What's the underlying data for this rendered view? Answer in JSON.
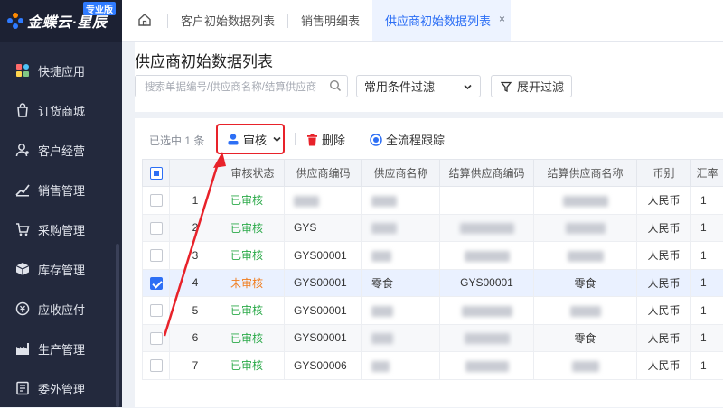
{
  "brand": {
    "name": "金蝶云·星辰",
    "edition": "专业版"
  },
  "sidebar": {
    "items": [
      {
        "label": "快捷应用",
        "icon": "grid-apps-icon"
      },
      {
        "label": "订货商城",
        "icon": "shopping-bag-icon"
      },
      {
        "label": "客户经营",
        "icon": "customer-icon"
      },
      {
        "label": "销售管理",
        "icon": "sales-chart-icon"
      },
      {
        "label": "采购管理",
        "icon": "shopping-cart-icon"
      },
      {
        "label": "库存管理",
        "icon": "box-icon"
      },
      {
        "label": "应收应付",
        "icon": "finance-icon"
      },
      {
        "label": "生产管理",
        "icon": "factory-icon"
      },
      {
        "label": "委外管理",
        "icon": "outsource-icon"
      }
    ]
  },
  "tabs": [
    {
      "label": "客户初始数据列表"
    },
    {
      "label": "销售明细表"
    },
    {
      "label": "供应商初始数据列表",
      "close": "×"
    }
  ],
  "page": {
    "title": "供应商初始数据列表",
    "search_placeholder": "搜索单据编号/供应商名称/结算供应商",
    "filter_label": "常用条件过滤",
    "expand_label": "展开过滤"
  },
  "toolbar": {
    "selected": "已选中 1 条",
    "audit": "审核",
    "delete": "删除",
    "trace": "全流程跟踪"
  },
  "table": {
    "headers": [
      "",
      "",
      "审核状态",
      "供应商编码",
      "供应商名称",
      "结算供应商编码",
      "结算供应商名称",
      "币别",
      "汇率"
    ],
    "rows": [
      {
        "no": "1",
        "status": "已审核",
        "code": "",
        "name": "",
        "settle_code": "",
        "settle_name": "",
        "currency": "人民币",
        "rate": "1"
      },
      {
        "no": "2",
        "status": "已审核",
        "code": "GYS",
        "name": "",
        "settle_code": "",
        "settle_name": "",
        "currency": "人民币",
        "rate": "1"
      },
      {
        "no": "3",
        "status": "已审核",
        "code": "GYS00001",
        "name": "",
        "settle_code": "",
        "settle_name": "",
        "currency": "人民币",
        "rate": "1"
      },
      {
        "no": "4",
        "status": "未审核",
        "code": "GYS00001",
        "name": "零食",
        "settle_code": "GYS00001",
        "settle_name": "零食",
        "currency": "人民币",
        "rate": "1"
      },
      {
        "no": "5",
        "status": "已审核",
        "code": "GYS00001",
        "name": "",
        "settle_code": "",
        "settle_name": "",
        "currency": "人民币",
        "rate": "1"
      },
      {
        "no": "6",
        "status": "已审核",
        "code": "GYS00001",
        "name": "",
        "settle_code": "",
        "settle_name": "零食",
        "currency": "人民币",
        "rate": "1"
      },
      {
        "no": "7",
        "status": "已审核",
        "code": "GYS00006",
        "name": "",
        "settle_code": "",
        "settle_name": "",
        "currency": "人民币",
        "rate": "1"
      }
    ]
  },
  "colors": {
    "accent": "#2d6ff5",
    "approved": "#2caa4a",
    "pending": "#f07d1e",
    "highlight": "#e8222a",
    "sidebar": "#23293d"
  }
}
